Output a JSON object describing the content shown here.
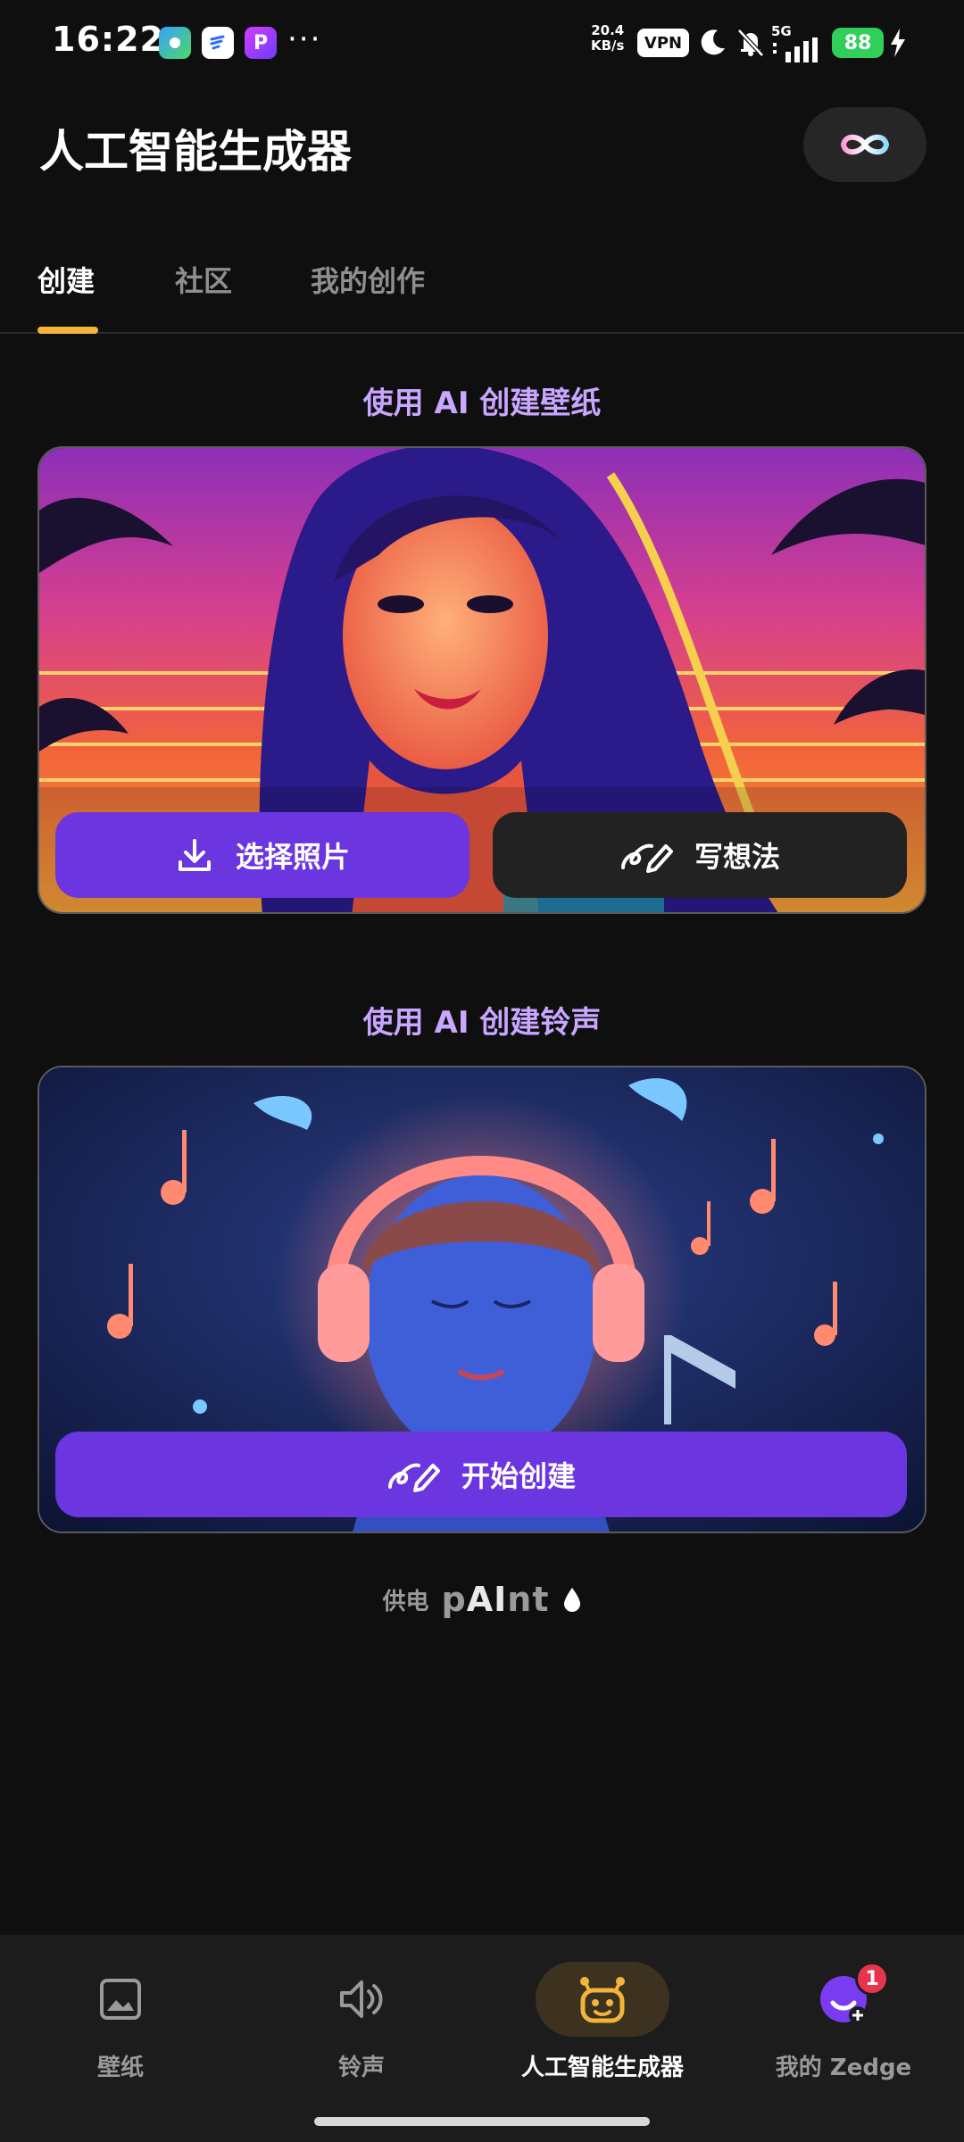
{
  "status_bar": {
    "time": "16:22",
    "net_speed_value": "20.4",
    "net_speed_unit": "KB/s",
    "vpn": "VPN",
    "network": "5G",
    "battery": "88",
    "more": "···"
  },
  "header": {
    "title": "人工智能生成器"
  },
  "tabs": [
    {
      "label": "创建",
      "active": true
    },
    {
      "label": "社区",
      "active": false
    },
    {
      "label": "我的创作",
      "active": false
    }
  ],
  "wallpaper_section": {
    "heading": "使用 AI 创建壁纸",
    "select_photo_label": "选择照片",
    "write_idea_label": "写想法"
  },
  "ringtone_section": {
    "heading": "使用 AI 创建铃声",
    "start_label": "开始创建"
  },
  "powered_by": {
    "prefix": "供电",
    "brand_p": "p",
    "brand_ai": "AI",
    "brand_nt": "nt"
  },
  "bottom_nav": [
    {
      "label": "壁纸",
      "icon": "image-icon",
      "active": false
    },
    {
      "label": "铃声",
      "icon": "speaker-icon",
      "active": false
    },
    {
      "label": "人工智能生成器",
      "icon": "robot-icon",
      "active": true
    },
    {
      "label": "我的 Zedge",
      "icon": "avatar-icon",
      "active": false,
      "badge": "1"
    }
  ],
  "colors": {
    "accent_purple": "#6b35e0",
    "tab_indicator": "#f2b53a",
    "heading_lilac": "#c9a6ff",
    "background": "#0f0f0f"
  }
}
